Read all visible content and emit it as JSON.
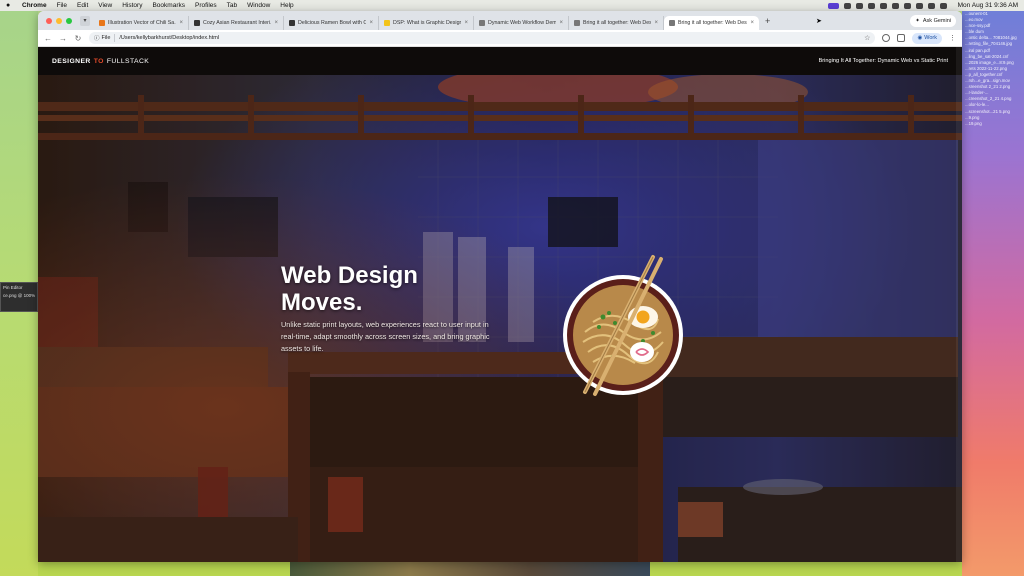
{
  "menubar": {
    "app": "Chrome",
    "items": [
      "File",
      "Edit",
      "View",
      "History",
      "Bookmarks",
      "Profiles",
      "Tab",
      "Window",
      "Help"
    ],
    "clock": "Mon Aug 31  9:36 AM"
  },
  "tabs": [
    {
      "title": "Illustration Vector of Chili Sa...",
      "color": "#e8761a"
    },
    {
      "title": "Cozy Asian Restaurant Interi...",
      "color": "#333333"
    },
    {
      "title": "Delicious Ramen Bowl with C...",
      "color": "#333333"
    },
    {
      "title": "DSP: What is Graphic Design...",
      "color": "#f2c318"
    },
    {
      "title": "Dynamic Web Workflow Dem...",
      "color": "#777777"
    },
    {
      "title": "Bring it all together: Web Des...",
      "color": "#777777"
    },
    {
      "title": "Bring it all together: Web Des...",
      "color": "#777777"
    }
  ],
  "toolbar": {
    "gemini_label": "Ask Gemini",
    "url_scheme": "File",
    "url": "/Users/kellybarkhurst/Desktop/index.html",
    "profile_label": "Work"
  },
  "site": {
    "logo_left": "DESIGNER",
    "logo_mid": "TO",
    "logo_right": "FULLSTACK",
    "header_right": "Bringing It All Together: Dynamic Web vs Static Print",
    "hero_title_line1": "Web Design",
    "hero_title_line2": "Moves.",
    "hero_body": "Unlike static print layouts, web experiences react to user input in real-time, adapt smoothly across screen sizes, and bring graphic assets to life."
  },
  "photoshop_panel": {
    "title": "Pin Editor",
    "file": "ce.png @ 100% (L"
  },
  "desktop_files": [
    "...ounent-01",
    "...eo.mov",
    "...nce-ssy.pdf",
    "...ble dum",
    "...ontic delta... 7081044.jpg",
    "...retting_file_704146.jpg",
    "...iral pan.pdf",
    "...ling_be_sat-2024.cnf",
    "...2026 image_e...8:9.png",
    "...rets 2022-11-22.png",
    "...p_all_together.cnf",
    "...rsh...e_gra...sign.mov",
    "...sreenshot 2_21 2.png",
    "...r-lander-...",
    "...creenshot_2_21 4.png",
    "...olor-lo-le...",
    "...screenshot...21 5.png",
    "...9.png",
    "...19.png"
  ],
  "colors": {
    "accent_logo_to": "#e04a2a",
    "tabbar_bg": "#dfe3e8",
    "site_header_bg": "#0e0b0a"
  }
}
